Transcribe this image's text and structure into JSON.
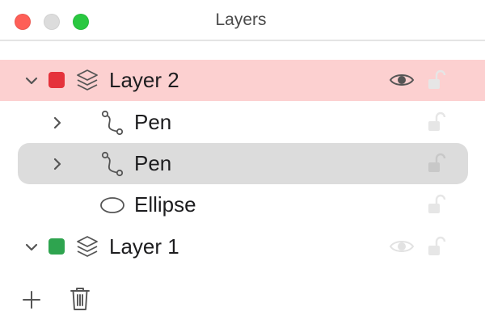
{
  "window": {
    "title": "Layers",
    "controls": [
      "close",
      "minimize",
      "zoom"
    ]
  },
  "layers": [
    {
      "name": "Layer 2",
      "color": "#e5323b",
      "icon": "layers-icon",
      "expanded": true,
      "selected": true,
      "visible": true,
      "locked": false,
      "children": [
        {
          "name": "Pen",
          "icon": "path-icon",
          "expandable": true,
          "selected": false,
          "locked": false
        },
        {
          "name": "Pen",
          "icon": "path-icon",
          "expandable": true,
          "selected": true,
          "locked": false
        },
        {
          "name": "Ellipse",
          "icon": "ellipse-icon",
          "expandable": false,
          "selected": false,
          "locked": false
        }
      ]
    },
    {
      "name": "Layer 1",
      "color": "#2ea44f",
      "icon": "layers-icon",
      "expanded": false,
      "selected": false,
      "visible": false,
      "locked": false,
      "children": []
    }
  ],
  "footer": {
    "buttons": [
      "add-icon",
      "trash-icon"
    ]
  },
  "colors": {
    "selected_layer_bg": "#fcd0d0",
    "selected_item_bg": "#dcdcdc"
  }
}
